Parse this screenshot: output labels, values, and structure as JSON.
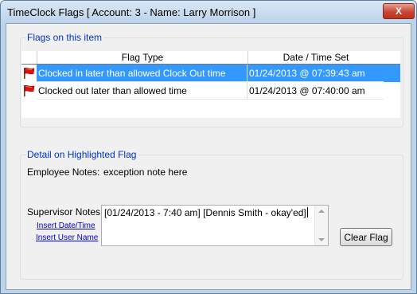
{
  "window": {
    "title": "TimeClock Flags [ Account: 3 - Name: Larry Morrison ]",
    "close_label": "X"
  },
  "flags_group": {
    "legend": "Flags on this item",
    "columns": [
      "Flag Type",
      "Date / Time Set"
    ],
    "rows": [
      {
        "flag_type": "Clocked in later than allowed Clock Out time",
        "date_time": "01/24/2013 @ 07:39:43 am",
        "selected": true,
        "icon": "red-flag-icon"
      },
      {
        "flag_type": "Clocked out later than allowed time",
        "date_time": "01/24/2013 @ 07:40:00 am",
        "selected": false,
        "icon": "red-flag-icon"
      }
    ]
  },
  "detail_group": {
    "legend": "Detail on Highlighted Flag",
    "employee_notes_label": "Employee Notes:",
    "employee_notes_value": "exception note here",
    "supervisor_notes_label": "Supervisor Notes:",
    "supervisor_notes_value": "[01/24/2013 - 7:40 am] [Dennis Smith - okay'ed]",
    "insert_date_link": "Insert Date/Time",
    "insert_user_link": "Insert User Name",
    "clear_flag_label": "Clear Flag"
  },
  "colors": {
    "selection": "#3399ff",
    "legend_text": "#0033cc",
    "link_text": "#0000cc",
    "flag_red": "#e01010"
  }
}
